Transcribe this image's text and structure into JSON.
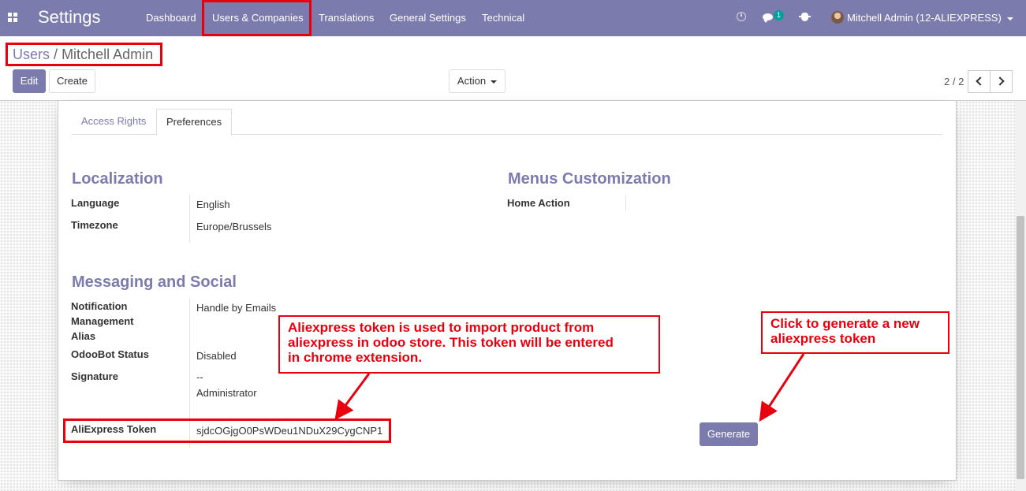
{
  "navbar": {
    "brand": "Settings",
    "menu": [
      "Dashboard",
      "Users & Companies",
      "Translations",
      "General Settings",
      "Technical"
    ],
    "chat_badge": "1",
    "user": "Mitchell Admin (12-ALIEXPRESS)",
    "icons": [
      "apps-icon",
      "clock-icon",
      "chat-icon",
      "bug-icon",
      "avatar"
    ]
  },
  "breadcrumb": {
    "parent": "Users",
    "separator": "/",
    "current": "Mitchell Admin"
  },
  "buttons": {
    "edit": "Edit",
    "create": "Create",
    "action": "Action",
    "generate": "Generate"
  },
  "pager": {
    "value": "2 / 2"
  },
  "tabs": [
    "Access Rights",
    "Preferences"
  ],
  "localization": {
    "title": "Localization",
    "language_label": "Language",
    "language_value": "English",
    "timezone_label": "Timezone",
    "timezone_value": "Europe/Brussels"
  },
  "menus": {
    "title": "Menus Customization",
    "home_action_label": "Home Action"
  },
  "messaging": {
    "title": "Messaging and Social",
    "notification_label_1": "Notification",
    "notification_label_2": "Management",
    "notification_value": "Handle by Emails",
    "alias_label": "Alias",
    "odoobot_label": "OdooBot Status",
    "odoobot_value": "Disabled",
    "signature_label": "Signature",
    "signature_line_1": "--",
    "signature_line_2": "Administrator"
  },
  "aliexpress": {
    "token_label": "AliExpress Token",
    "token_value": "sjdcOGjgO0PsWDeu1NDuX29CygCNP1"
  },
  "annotations": {
    "token_note_1": "Aliexpress token is used to import product from",
    "token_note_2": "aliexpress in odoo store. This token will be entered",
    "token_note_3": "in chrome extension.",
    "generate_note_1": "Click to generate a new",
    "generate_note_2": "aliexpress token"
  },
  "colors": {
    "brand": "#7c7bad",
    "annotation": "#e8000f",
    "badge": "#00a09d"
  }
}
